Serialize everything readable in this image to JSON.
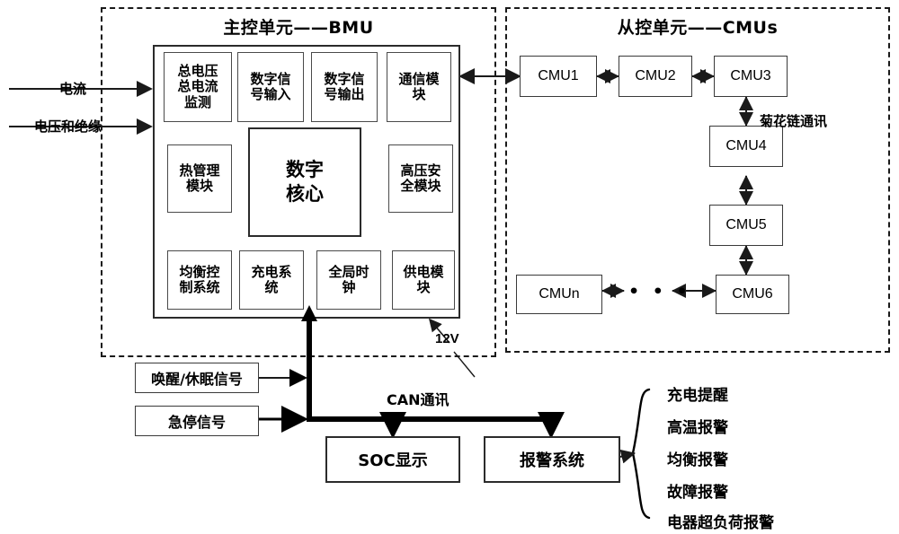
{
  "diagram": {
    "title_bmu": "主控单元——BMU",
    "title_cmus": "从控单元——CMUs"
  },
  "inputs": {
    "current": "电流",
    "voltage_insulation": "电压和绝缘"
  },
  "bmu": {
    "modules_row1": [
      {
        "id": "total-voltage-current-monitor",
        "label": "总电压\n总电流\n监测"
      },
      {
        "id": "digital-signal-input",
        "label": "数字信\n号输入"
      },
      {
        "id": "digital-signal-output",
        "label": "数字信\n号输出"
      },
      {
        "id": "communication-module",
        "label": "通信模\n块"
      }
    ],
    "modules_row2": [
      {
        "id": "thermal-management-module",
        "label": "热管理\n模块"
      },
      {
        "id": "digital-core",
        "label": "数字\n核心"
      },
      {
        "id": "high-voltage-safety-module",
        "label": "高压安\n全模块"
      }
    ],
    "modules_row3": [
      {
        "id": "balance-control-system",
        "label": "均衡控\n制系统"
      },
      {
        "id": "charging-system",
        "label": "充电系\n统"
      },
      {
        "id": "global-clock",
        "label": "全局时\n钟"
      },
      {
        "id": "power-supply-module",
        "label": "供电模\n块"
      }
    ],
    "power_label": "12V"
  },
  "cmus": {
    "units": [
      {
        "id": "cmu1",
        "label": "CMU1"
      },
      {
        "id": "cmu2",
        "label": "CMU2"
      },
      {
        "id": "cmu3",
        "label": "CMU3"
      },
      {
        "id": "cmu4",
        "label": "CMU4"
      },
      {
        "id": "cmu5",
        "label": "CMU5"
      },
      {
        "id": "cmu6",
        "label": "CMU6"
      },
      {
        "id": "cmun",
        "label": "CMUn"
      }
    ],
    "daisy_chain_label": "菊花链通讯",
    "ellipsis": "•  •  •"
  },
  "signals": {
    "wake_sleep": "唤醒/休眠信号",
    "emergency_stop": "急停信号",
    "can_bus": "CAN通讯"
  },
  "outputs": [
    {
      "id": "soc-display",
      "label": "SOC显示"
    },
    {
      "id": "alarm-system",
      "label": "报警系统"
    }
  ],
  "alarms": [
    "充电提醒",
    "高温报警",
    "均衡报警",
    "故障报警",
    "电器超负荷报警"
  ],
  "colors": {
    "line": "#1a1a1a",
    "box_border": "#2b2b2b",
    "background": "#ffffff"
  }
}
